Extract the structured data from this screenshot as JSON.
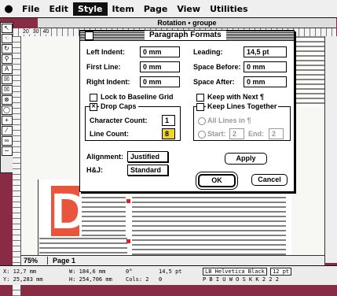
{
  "menubar": {
    "apple": "",
    "items": [
      "File",
      "Edit",
      "Style",
      "Item",
      "Page",
      "View",
      "Utilities"
    ],
    "active_index": 2
  },
  "document": {
    "title": "Rotation • groupe",
    "ruler_marks": [
      "20",
      "30",
      "40"
    ],
    "zoom": "75%",
    "page_label": "Page 1"
  },
  "dialog": {
    "title": "Paragraph Formats",
    "left_indent": {
      "label": "Left Indent:",
      "value": "0 mm"
    },
    "first_line": {
      "label": "First Line:",
      "value": "0 mm"
    },
    "right_indent": {
      "label": "Right Indent:",
      "value": "0 mm"
    },
    "leading": {
      "label": "Leading:",
      "value": "14,5 pt"
    },
    "space_before": {
      "label": "Space Before:",
      "value": "0 mm"
    },
    "space_after": {
      "label": "Space After:",
      "value": "0 mm"
    },
    "lock_baseline": {
      "label": "Lock to Baseline Grid",
      "checked": false
    },
    "keep_with_next": {
      "label": "Keep with Next ¶",
      "checked": false
    },
    "drop_caps": {
      "label": "Drop Caps",
      "checked": true
    },
    "character_count": {
      "label": "Character Count:",
      "value": "1"
    },
    "line_count": {
      "label": "Line Count:",
      "value": "8"
    },
    "keep_lines": {
      "label": "Keep Lines Together",
      "checked": false
    },
    "all_lines": {
      "label": "All Lines in ¶"
    },
    "start": {
      "label": "Start:",
      "value": "2"
    },
    "end": {
      "label": "End:",
      "value": "2"
    },
    "alignment": {
      "label": "Alignment:",
      "value": "Justified"
    },
    "hj": {
      "label": "H&J:",
      "value": "Standard"
    },
    "apply_label": "Apply",
    "ok_label": "OK",
    "cancel_label": "Cancel"
  },
  "measurements": {
    "x": "X: 12,7 mm",
    "y": "Y: 25,283 mm",
    "w": "W: 184,6 mm",
    "h": "H: 254,706 mm",
    "angle": "0°",
    "cols": "Cols: 2",
    "leading": "14,5 pt",
    "tracking": "0",
    "font": "LB Helvetica Black",
    "size": "12 pt"
  },
  "colors": {
    "accent_dropcap": "#e8553c",
    "background": "#8a2b45",
    "highlight": "#f2d72a"
  }
}
